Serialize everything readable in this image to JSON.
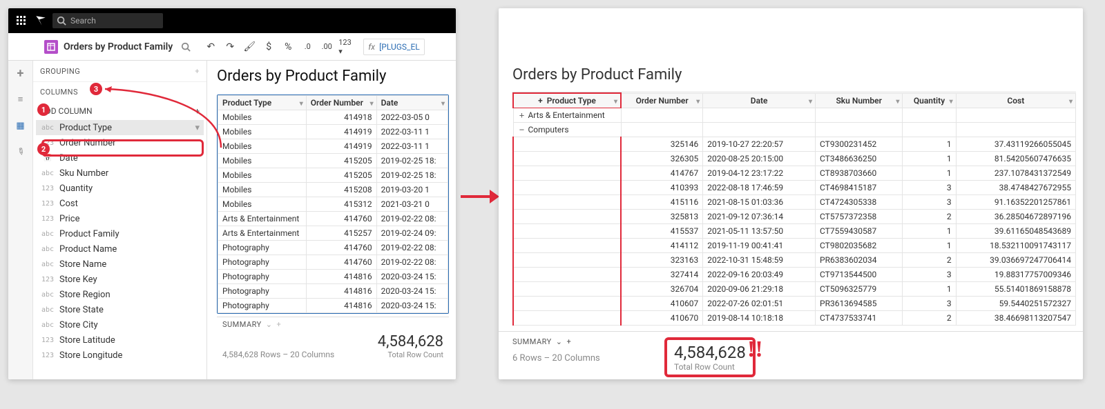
{
  "topbar": {
    "search_placeholder": "Search"
  },
  "titlebar": {
    "sheet_title": "Orders by Product Family",
    "fx_text": "[PLUGS_EL"
  },
  "side": {
    "grouping_label": "GROUPING",
    "columns_label": "COLUMNS",
    "add_column_label": "ADD COLUMN",
    "items": [
      {
        "type": "abc",
        "name": "Product Type",
        "selected": true
      },
      {
        "type": "123",
        "name": "Order Number"
      },
      {
        "type": "cal",
        "name": "Date"
      },
      {
        "type": "abc",
        "name": "Sku Number"
      },
      {
        "type": "123",
        "name": "Quantity"
      },
      {
        "type": "123",
        "name": "Cost"
      },
      {
        "type": "123",
        "name": "Price"
      },
      {
        "type": "abc",
        "name": "Product Family"
      },
      {
        "type": "abc",
        "name": "Product Name"
      },
      {
        "type": "abc",
        "name": "Store Name"
      },
      {
        "type": "123",
        "name": "Store Key"
      },
      {
        "type": "abc",
        "name": "Store Region"
      },
      {
        "type": "abc",
        "name": "Store State"
      },
      {
        "type": "abc",
        "name": "Store City"
      },
      {
        "type": "123",
        "name": "Store Latitude"
      },
      {
        "type": "123",
        "name": "Store Longitude"
      }
    ]
  },
  "left_grid": {
    "title": "Orders by Product Family",
    "cols": [
      "Product Type",
      "Order Number",
      "Date"
    ],
    "rows": [
      [
        "Mobiles",
        "414918",
        "2022-03-05 0"
      ],
      [
        "Mobiles",
        "414919",
        "2022-03-11 1"
      ],
      [
        "Mobiles",
        "414919",
        "2022-03-11 1"
      ],
      [
        "Mobiles",
        "415205",
        "2019-02-25 18:"
      ],
      [
        "Mobiles",
        "415205",
        "2019-02-25 18:"
      ],
      [
        "Mobiles",
        "415208",
        "2019-03-20 1"
      ],
      [
        "Mobiles",
        "415312",
        "2021-03-21 0"
      ],
      [
        "Arts & Entertainment",
        "414760",
        "2019-02-22 08:"
      ],
      [
        "Arts & Entertainment",
        "415257",
        "2019-02-24 09:"
      ],
      [
        "Photography",
        "414760",
        "2019-02-22 08:"
      ],
      [
        "Photography",
        "414760",
        "2019-02-22 08:"
      ],
      [
        "Photography",
        "414816",
        "2020-03-24 15:"
      ],
      [
        "Photography",
        "414816",
        "2020-03-24 15:"
      ],
      [
        "Photography",
        "414816",
        "2020-03-24 15:"
      ]
    ]
  },
  "left_summary": {
    "label": "SUMMARY",
    "meta": "4,584,628 Rows – 20 Columns",
    "total_value": "4,584,628",
    "total_label": "Total Row Count"
  },
  "right_grid": {
    "title": "Orders by Product Family",
    "cols": [
      "Product Type",
      "Order Number",
      "Date",
      "Sku Number",
      "Quantity",
      "Cost"
    ],
    "groups": [
      {
        "pm": "+",
        "name": "Arts & Entertainment"
      },
      {
        "pm": "−",
        "name": "Computers"
      }
    ],
    "rows": [
      [
        "325146",
        "2019-10-27 22:20:57",
        "CT9300231452",
        "1",
        "37.43119266055045"
      ],
      [
        "326305",
        "2020-08-25 20:15:00",
        "CT3486636250",
        "1",
        "81.54205607476635"
      ],
      [
        "414767",
        "2019-04-12 23:17:22",
        "CT8938703660",
        "1",
        "237.1078431372549"
      ],
      [
        "410393",
        "2022-08-18 17:46:59",
        "CT4698415187",
        "3",
        "38.4748427672955"
      ],
      [
        "415116",
        "2021-08-15 01:03:36",
        "CT4724305338",
        "3",
        "91.16352201257861"
      ],
      [
        "325813",
        "2021-09-12 07:36:14",
        "CT5757372358",
        "2",
        "36.28504672897196"
      ],
      [
        "415537",
        "2021-05-11 13:57:50",
        "CT7559430587",
        "1",
        "39.61165048543689"
      ],
      [
        "414112",
        "2019-11-19 00:41:41",
        "CT9802035682",
        "1",
        "18.532110091743117"
      ],
      [
        "323163",
        "2022-10-31 15:48:59",
        "PR6383602034",
        "2",
        "39.036697247706414"
      ],
      [
        "327414",
        "2022-09-16 20:03:49",
        "CT9713544500",
        "3",
        "19.88317757009346"
      ],
      [
        "326704",
        "2020-09-06 21:29:18",
        "CT5096325779",
        "1",
        "55.51401869158878"
      ],
      [
        "410607",
        "2022-07-26 02:01:51",
        "PR3613694585",
        "3",
        "59.5440251572327"
      ],
      [
        "410670",
        "2019-08-14 10:18:18",
        "CT4737533741",
        "2",
        "38.46698113207547"
      ]
    ]
  },
  "right_summary": {
    "label": "SUMMARY",
    "meta": "6 Rows – 20 Columns",
    "total_value": "4,584,628",
    "total_label": "Total Row Count"
  }
}
